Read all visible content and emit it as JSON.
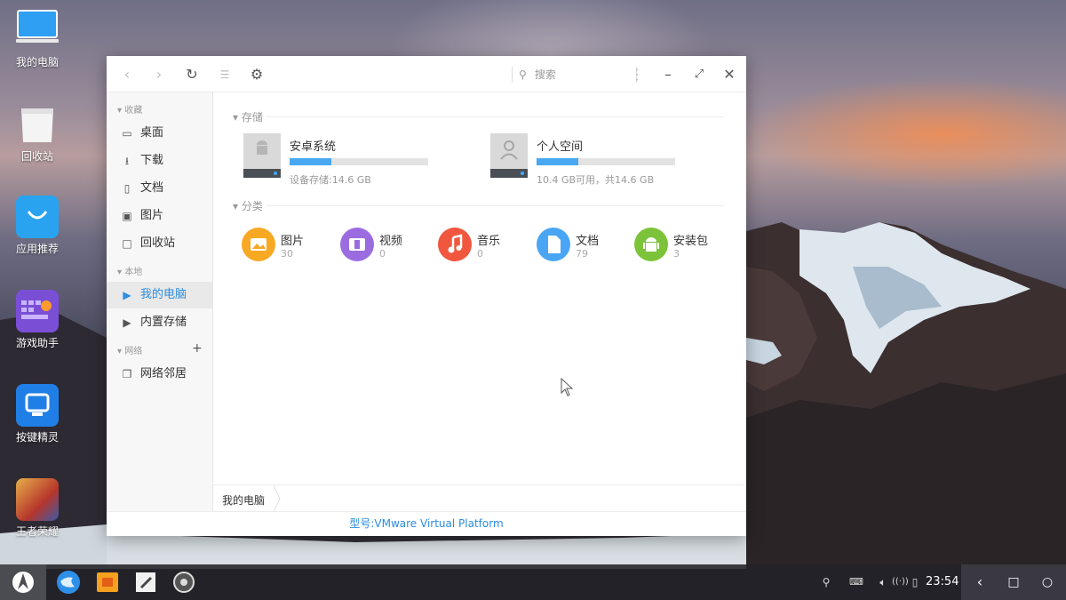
{
  "desktop": {
    "icons": [
      {
        "label": "我的电脑",
        "icon": "computer-icon"
      },
      {
        "label": "回收站",
        "icon": "recycle-bin-icon"
      },
      {
        "label": "应用推荐",
        "icon": "app-store-icon"
      },
      {
        "label": "游戏助手",
        "icon": "game-keyboard-icon"
      },
      {
        "label": "按键精灵",
        "icon": "key-sprite-icon"
      },
      {
        "label": "王者荣耀",
        "icon": "honor-of-kings-icon"
      }
    ]
  },
  "window": {
    "toolbar": {
      "back": "back-icon",
      "forward": "forward-icon",
      "refresh": "refresh-icon",
      "view": "grid-view-icon",
      "settings": "gear-icon",
      "search_placeholder": "搜索",
      "menu": "more-icon",
      "minimize": "minimize-icon",
      "maximize": "maximize-icon",
      "close": "close-icon"
    },
    "sidebar": {
      "sec_favorites": "收藏",
      "favorites": [
        {
          "label": "桌面",
          "icon": "desktop-icon"
        },
        {
          "label": "下载",
          "icon": "download-icon"
        },
        {
          "label": "文档",
          "icon": "document-icon"
        },
        {
          "label": "图片",
          "icon": "image-icon"
        },
        {
          "label": "回收站",
          "icon": "trash-icon"
        }
      ],
      "sec_local": "本地",
      "local": [
        {
          "label": "我的电脑",
          "active": true
        },
        {
          "label": "内置存储",
          "active": false
        }
      ],
      "sec_network": "网络",
      "network": [
        {
          "label": "网络邻居",
          "icon": "network-neighborhood-icon"
        }
      ]
    },
    "content": {
      "storage_title": "存储",
      "drives": [
        {
          "name": "安卓系统",
          "info": "设备存储:14.6 GB",
          "used_fraction": 0.3,
          "icon": "android-drive-icon"
        },
        {
          "name": "个人空间",
          "info": "10.4 GB可用，共14.6 GB",
          "used_fraction": 0.3,
          "icon": "user-drive-icon"
        }
      ],
      "category_title": "分类",
      "categories": [
        {
          "name": "图片",
          "count": "30",
          "color": "#f7a924",
          "icon": "picture-icon"
        },
        {
          "name": "视频",
          "count": "0",
          "color": "#9b6ce0",
          "icon": "video-icon"
        },
        {
          "name": "音乐",
          "count": "0",
          "color": "#f0573e",
          "icon": "music-icon"
        },
        {
          "name": "文档",
          "count": "79",
          "color": "#4aa6f5",
          "icon": "doc-icon"
        },
        {
          "name": "安装包",
          "count": "3",
          "color": "#7cc33a",
          "icon": "apk-icon"
        }
      ]
    },
    "breadcrumb": "我的电脑",
    "status": "型号:VMware Virtual Platform"
  },
  "taskbar": {
    "time": "23:54",
    "apps": [
      "browser-icon",
      "file-manager-icon",
      "notes-icon",
      "settings-icon"
    ],
    "tray": [
      "search-icon",
      "keyboard-icon",
      "volume-icon",
      "network-icon",
      "battery-icon"
    ],
    "nav": [
      "back-icon",
      "home-icon",
      "recents-icon"
    ]
  }
}
